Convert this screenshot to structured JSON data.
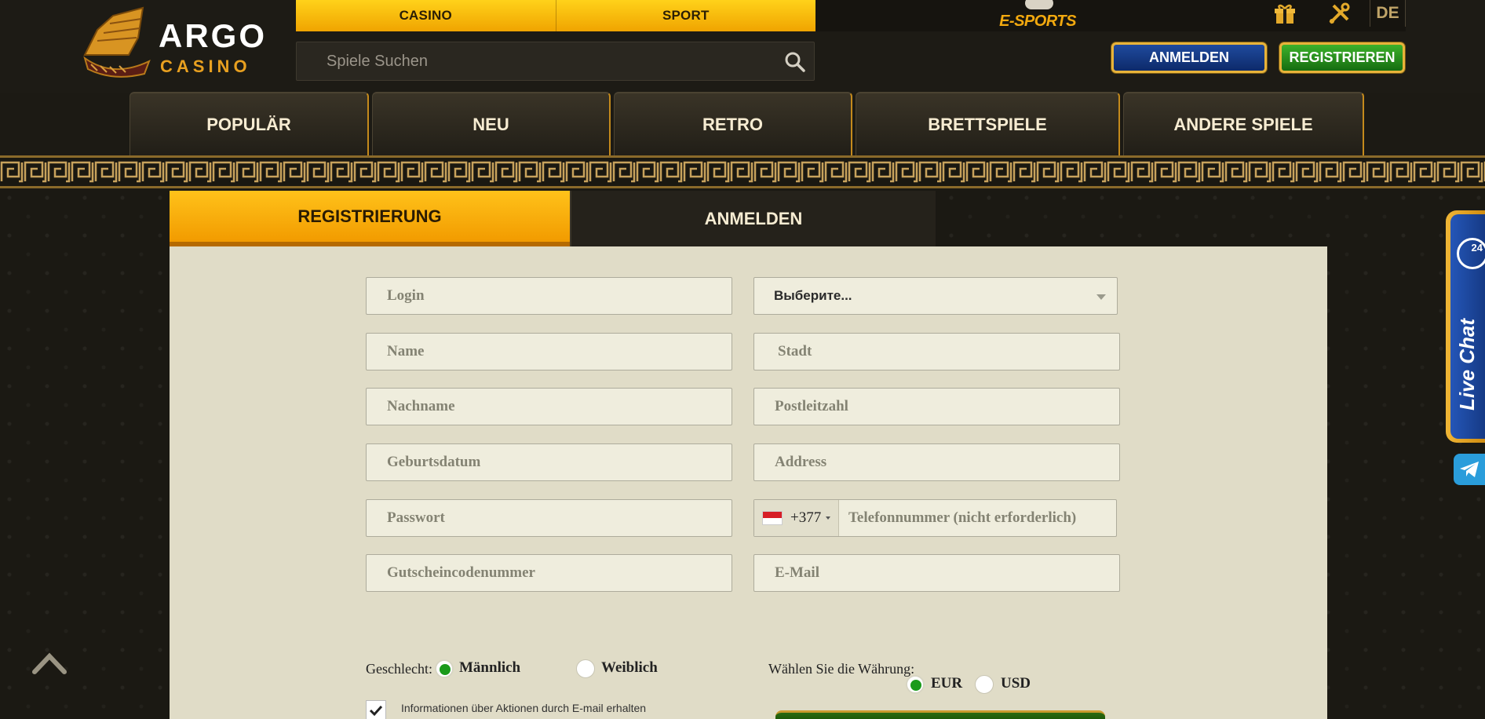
{
  "brand": {
    "line1": "ARGO",
    "line2": "CASINO"
  },
  "top_tabs": [
    {
      "label": "CASINO"
    },
    {
      "label": "SPORT"
    }
  ],
  "esports": {
    "label": "E-SPORTS"
  },
  "language": "DE",
  "search": {
    "placeholder": "Spiele Suchen"
  },
  "header_buttons": {
    "login": "ANMELDEN",
    "register": "REGISTRIEREN"
  },
  "categories": [
    {
      "label": "POPULÄR"
    },
    {
      "label": "NEU"
    },
    {
      "label": "RETRO"
    },
    {
      "label": "BRETTSPIELE"
    },
    {
      "label": "ANDERE SPIELE"
    }
  ],
  "auth_tabs": {
    "register": "REGISTRIERUNG",
    "login": "ANMELDEN"
  },
  "form": {
    "login": {
      "placeholder": "Login",
      "value": ""
    },
    "country": {
      "value": "Выберите..."
    },
    "name": {
      "placeholder": "Name",
      "value": ""
    },
    "city": {
      "placeholder": "Stadt",
      "value": ""
    },
    "surname": {
      "placeholder": "Nachname",
      "value": ""
    },
    "postcode": {
      "placeholder": "Postleitzahl",
      "value": ""
    },
    "birthdate": {
      "placeholder": "Geburtsdatum",
      "value": ""
    },
    "address": {
      "placeholder": "Address",
      "value": ""
    },
    "password": {
      "placeholder": "Passwort",
      "value": ""
    },
    "phone": {
      "prefix": "+377",
      "placeholder": "Telefonnummer (nicht erforderlich)",
      "value": ""
    },
    "voucher": {
      "placeholder": "Gutscheincodenummer",
      "value": ""
    },
    "email": {
      "placeholder": "E-Mail",
      "value": ""
    },
    "gender": {
      "label": "Geschlecht:",
      "options": [
        "Männlich",
        "Weiblich"
      ],
      "selected": "Männlich"
    },
    "currency": {
      "label": "Wählen Sie die Währung:",
      "options": [
        "EUR",
        "USD"
      ],
      "selected": "EUR"
    },
    "newsletter": {
      "label": "Informationen über Aktionen durch E-mail erhalten",
      "checked": true
    }
  },
  "live_chat": {
    "label": "Live Chat",
    "badge": "24"
  },
  "colors": {
    "accent_gold": "#f5b400",
    "login_blue": "#1f4a9e",
    "register_green": "#2f9a20",
    "panel_bg": "#e0dcc7",
    "radio_green": "#1a9a1a"
  }
}
